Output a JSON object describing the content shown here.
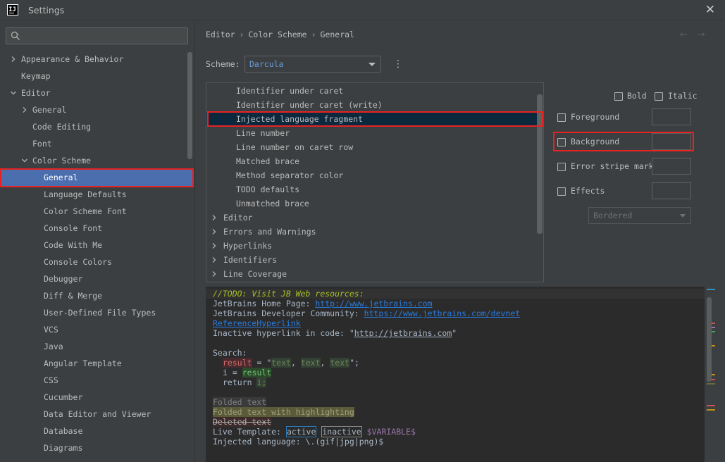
{
  "window": {
    "title": "Settings",
    "app_icon": "IJ",
    "close_glyph": "✕"
  },
  "sidebar": {
    "search_placeholder": "",
    "items": [
      {
        "label": "Appearance & Behavior",
        "expander": "collapsed"
      },
      {
        "label": "Keymap",
        "expander": "none"
      },
      {
        "label": "Editor",
        "expander": "expanded"
      },
      {
        "label": "General",
        "expander": "collapsed"
      },
      {
        "label": "Code Editing",
        "expander": "none"
      },
      {
        "label": "Font",
        "expander": "none"
      },
      {
        "label": "Color Scheme",
        "expander": "expanded"
      },
      {
        "label": "General",
        "expander": "none",
        "selected": true
      },
      {
        "label": "Language Defaults",
        "expander": "none"
      },
      {
        "label": "Color Scheme Font",
        "expander": "none"
      },
      {
        "label": "Console Font",
        "expander": "none"
      },
      {
        "label": "Code With Me",
        "expander": "none"
      },
      {
        "label": "Console Colors",
        "expander": "none"
      },
      {
        "label": "Debugger",
        "expander": "none"
      },
      {
        "label": "Diff & Merge",
        "expander": "none"
      },
      {
        "label": "User-Defined File Types",
        "expander": "none"
      },
      {
        "label": "VCS",
        "expander": "none"
      },
      {
        "label": "Java",
        "expander": "none"
      },
      {
        "label": "Angular Template",
        "expander": "none"
      },
      {
        "label": "CSS",
        "expander": "none"
      },
      {
        "label": "Cucumber",
        "expander": "none"
      },
      {
        "label": "Data Editor and Viewer",
        "expander": "none"
      },
      {
        "label": "Database",
        "expander": "none"
      },
      {
        "label": "Diagrams",
        "expander": "none"
      }
    ]
  },
  "breadcrumb": {
    "items": [
      "Editor",
      "Color Scheme",
      "General"
    ],
    "separator": "›",
    "back": "←",
    "forward": "→"
  },
  "scheme": {
    "label": "Scheme:",
    "value": "Darcula",
    "more": "⋮"
  },
  "attributes": {
    "items": [
      {
        "label": "Identifier under caret",
        "expander": "none"
      },
      {
        "label": "Identifier under caret (write)",
        "expander": "none"
      },
      {
        "label": "Injected language fragment",
        "expander": "none",
        "selected": true
      },
      {
        "label": "Line number",
        "expander": "none"
      },
      {
        "label": "Line number on caret row",
        "expander": "none"
      },
      {
        "label": "Matched brace",
        "expander": "none"
      },
      {
        "label": "Method separator color",
        "expander": "none"
      },
      {
        "label": "TODO defaults",
        "expander": "none"
      },
      {
        "label": "Unmatched brace",
        "expander": "none"
      },
      {
        "label": "Editor",
        "expander": "collapsed"
      },
      {
        "label": "Errors and Warnings",
        "expander": "collapsed"
      },
      {
        "label": "Hyperlinks",
        "expander": "collapsed"
      },
      {
        "label": "Identifiers",
        "expander": "collapsed"
      },
      {
        "label": "Line Coverage",
        "expander": "collapsed"
      }
    ]
  },
  "options": {
    "bold": "Bold",
    "italic": "Italic",
    "foreground": "Foreground",
    "background": "Background",
    "error_stripe": "Error stripe mark",
    "effects": "Effects",
    "effect_type": "Bordered",
    "checked": {
      "bold": false,
      "italic": false,
      "foreground": false,
      "background": false,
      "error_stripe": false,
      "effects": false
    }
  },
  "preview": {
    "todo": "//TODO: Visit JB Web resources:",
    "home_label": "JetBrains Home Page: ",
    "home_url": "http://www.jetbrains.com",
    "community_label": "JetBrains Developer Community: ",
    "community_url": "https://www.jetbrains.com/devnet",
    "reference": "ReferenceHyperlink",
    "inactive_label": "Inactive hyperlink in code: \"",
    "inactive_url": "http://jetbrains.com",
    "inactive_end": "\"",
    "search": "Search:",
    "result1": "result",
    "eq1": " = \"",
    "text1": "text",
    "comma1": ", ",
    "text2": "text",
    "comma2": ", ",
    "text3": "text",
    "end1": "\";",
    "i_var": "i",
    "eq2": " = ",
    "result2": "result",
    "return_kw": "return ",
    "i_ret": "i;",
    "folded": "Folded text",
    "folded_hl": "Folded text with highlighting",
    "deleted": "Deleted text",
    "live_label": "Live Template: ",
    "live_active": "active",
    "live_inactive": "inactive",
    "live_var": "$VARIABLE$",
    "injected": "Injected language: \\.(gif|jpg|png)$"
  },
  "colors": {
    "accent": "#4b6eaf",
    "highlight_box": "#e52323",
    "scheme_text": "#6a9bd8",
    "selected_row": "#0d293e"
  },
  "icons": {
    "search": "search-icon",
    "chevron_right": "chevron-right-icon",
    "chevron_down": "chevron-down-icon",
    "close": "close-icon",
    "back": "arrow-left-icon",
    "forward": "arrow-right-icon",
    "more": "more-vertical-icon"
  }
}
